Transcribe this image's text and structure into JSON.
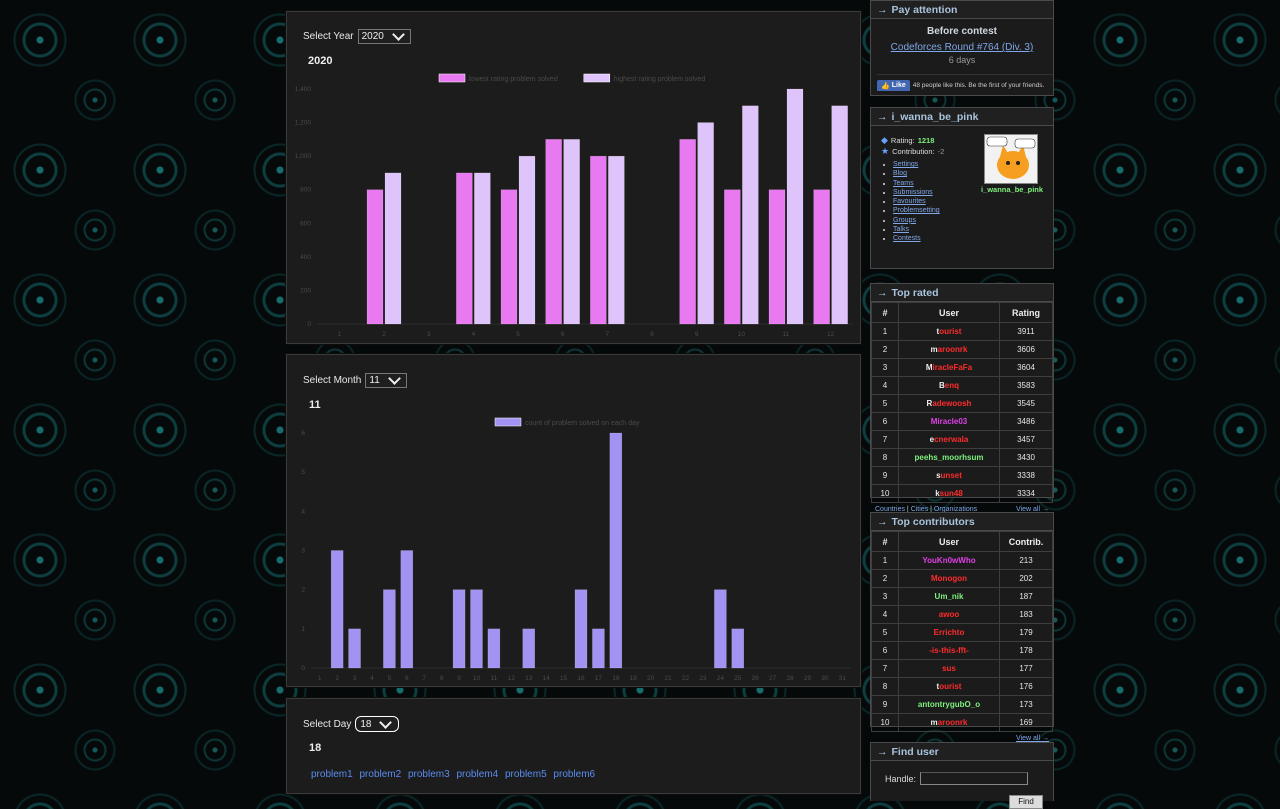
{
  "year_section": {
    "select_label": "Select Year",
    "selected": "2020",
    "heading": "2020"
  },
  "year_chart": {
    "type": "bar",
    "legend": [
      "lowest rating problem solved",
      "highest rating problem solved"
    ],
    "colors": [
      "#e879f0",
      "#dfc4fb"
    ],
    "categories": [
      "1",
      "2",
      "3",
      "4",
      "5",
      "6",
      "7",
      "8",
      "9",
      "10",
      "11",
      "12"
    ],
    "series": [
      {
        "name": "lowest rating problem solved",
        "values": [
          0,
          800,
          0,
          900,
          800,
          1100,
          1000,
          0,
          1100,
          800,
          800,
          800
        ]
      },
      {
        "name": "highest rating problem solved",
        "values": [
          0,
          900,
          0,
          900,
          1000,
          1100,
          1000,
          0,
          1200,
          1300,
          1400,
          1300
        ]
      }
    ],
    "yticks": [
      "0",
      "200",
      "400",
      "600",
      "800",
      "1,000",
      "1,200",
      "1,400"
    ],
    "ylim": [
      0,
      1400
    ]
  },
  "month_section": {
    "select_label": "Select Month",
    "selected": "11",
    "heading": "11"
  },
  "month_chart": {
    "type": "bar",
    "legend": [
      "count of problem solved on each day"
    ],
    "colors": [
      "#a293f2"
    ],
    "categories": [
      "1",
      "2",
      "3",
      "4",
      "5",
      "6",
      "7",
      "8",
      "9",
      "10",
      "11",
      "12",
      "13",
      "14",
      "15",
      "16",
      "17",
      "18",
      "19",
      "20",
      "21",
      "22",
      "23",
      "24",
      "25",
      "26",
      "27",
      "28",
      "29",
      "30",
      "31"
    ],
    "values": [
      0,
      3,
      1,
      0,
      2,
      3,
      0,
      0,
      2,
      2,
      1,
      0,
      1,
      0,
      0,
      2,
      1,
      6,
      0,
      0,
      0,
      0,
      0,
      2,
      1,
      0,
      0,
      0,
      0,
      0,
      0
    ],
    "yticks": [
      "0",
      "1",
      "2",
      "3",
      "4",
      "5",
      "6"
    ],
    "ylim": [
      0,
      6
    ]
  },
  "day_section": {
    "select_label": "Select Day",
    "selected": "18",
    "heading": "18",
    "problems": [
      "problem1",
      "problem2",
      "problem3",
      "problem4",
      "problem5",
      "problem6"
    ]
  },
  "pay_attention": {
    "title": "Pay attention",
    "before": "Before contest",
    "contest_link": "Codeforces Round #764 (Div. 3)",
    "countdown": "6 days",
    "like_button": "Like",
    "like_text": "48 people like this. Be the first of your friends."
  },
  "user_box": {
    "title": "i_wanna_be_pink",
    "rating_label": "Rating:",
    "rating": "1218",
    "contribution_label": "Contribution:",
    "contribution": "-2",
    "handle": "i_wanna_be_pink",
    "links": [
      "Settings",
      "Blog",
      "Teams",
      "Submissions",
      "Favourites",
      "Problemsetting",
      "Groups",
      "Talks",
      "Contests"
    ]
  },
  "top_rated": {
    "title": "Top rated",
    "headers": [
      "#",
      "User",
      "Rating"
    ],
    "rows": [
      {
        "rank": "1",
        "user": "tourist",
        "score": "3911",
        "color": "#ff2b2b",
        "first": "#eeeeee"
      },
      {
        "rank": "2",
        "user": "maroonrk",
        "score": "3606",
        "color": "#ff2b2b",
        "first": "#eeeeee"
      },
      {
        "rank": "3",
        "user": "MiracleFaFa",
        "score": "3604",
        "color": "#ff2b2b",
        "first": "#eeeeee"
      },
      {
        "rank": "4",
        "user": "Benq",
        "score": "3583",
        "color": "#ff2b2b",
        "first": "#eeeeee"
      },
      {
        "rank": "5",
        "user": "Radewoosh",
        "score": "3545",
        "color": "#ff2b2b",
        "first": "#eeeeee"
      },
      {
        "rank": "6",
        "user": "Miracle03",
        "score": "3486",
        "color": "#e040e8",
        "first": "#e040e8"
      },
      {
        "rank": "7",
        "user": "ecnerwala",
        "score": "3457",
        "color": "#ff2b2b",
        "first": "#eeeeee"
      },
      {
        "rank": "8",
        "user": "peehs_moorhsum",
        "score": "3430",
        "color": "#7ef07e",
        "first": "#7ef07e"
      },
      {
        "rank": "9",
        "user": "sunset",
        "score": "3338",
        "color": "#ff2b2b",
        "first": "#eeeeee"
      },
      {
        "rank": "10",
        "user": "ksun48",
        "score": "3334",
        "color": "#ff2b2b",
        "first": "#eeeeee"
      }
    ],
    "footer_links": [
      "Countries",
      "Cities",
      "Organizations"
    ],
    "view_all": "View all →"
  },
  "top_contributors": {
    "title": "Top contributors",
    "headers": [
      "#",
      "User",
      "Contrib."
    ],
    "rows": [
      {
        "rank": "1",
        "user": "YouKn0wWho",
        "score": "213",
        "color": "#e040e8",
        "first": "#e040e8"
      },
      {
        "rank": "2",
        "user": "Monogon",
        "score": "202",
        "color": "#ff2b2b",
        "first": "#ff2b2b"
      },
      {
        "rank": "3",
        "user": "Um_nik",
        "score": "187",
        "color": "#7ef07e",
        "first": "#7ef07e"
      },
      {
        "rank": "4",
        "user": "awoo",
        "score": "183",
        "color": "#ff2b2b",
        "first": "#ff2b2b"
      },
      {
        "rank": "5",
        "user": "Errichto",
        "score": "179",
        "color": "#ff2b2b",
        "first": "#ff2b2b"
      },
      {
        "rank": "6",
        "user": "-is-this-fft-",
        "score": "178",
        "color": "#ff2b2b",
        "first": "#ff2b2b"
      },
      {
        "rank": "7",
        "user": "sus",
        "score": "177",
        "color": "#ff2b2b",
        "first": "#ff2b2b"
      },
      {
        "rank": "8",
        "user": "tourist",
        "score": "176",
        "color": "#ff2b2b",
        "first": "#eeeeee"
      },
      {
        "rank": "9",
        "user": "antontrygubO_o",
        "score": "173",
        "color": "#7ef07e",
        "first": "#7ef07e"
      },
      {
        "rank": "10",
        "user": "maroonrk",
        "score": "169",
        "color": "#ff2b2b",
        "first": "#eeeeee"
      }
    ],
    "view_all": "View all →"
  },
  "find_user": {
    "title": "Find user",
    "handle_label": "Handle:",
    "find_button": "Find"
  }
}
